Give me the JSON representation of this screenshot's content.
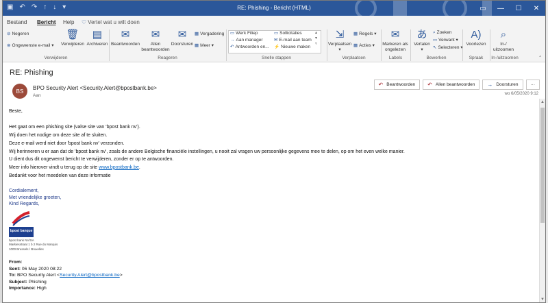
{
  "window": {
    "title": "RE: Phishing  -  Bericht (HTML)"
  },
  "tabs": [
    {
      "label": "Bestand"
    },
    {
      "label": "Bericht"
    },
    {
      "label": "Help"
    }
  ],
  "tell_me": "Vertel wat u wilt doen",
  "ribbon": {
    "delete": {
      "negeren": "Negeren",
      "junk": "Ongewenste e-mail",
      "verwijderen": "Verwijderen",
      "archiveren": "Archiveren",
      "group": "Verwijderen"
    },
    "respond": {
      "beantwoorden": "Beantwoorden",
      "allen": "Allen beantwoorden",
      "doorsturen": "Doorsturen",
      "vergadering": "Vergadering",
      "meer": "Meer",
      "group": "Reageren"
    },
    "quick": {
      "items": [
        "Werk Filiep",
        "Aan manager",
        "Antwoorden en...",
        "Sollicitaties",
        "E-mail aan team",
        "Nieuwe maken"
      ],
      "group": "Snelle stappen"
    },
    "move": {
      "verplaatsen": "Verplaatsen",
      "regels": "Regels",
      "acties": "Acties",
      "group": "Verplaatsen"
    },
    "tags": {
      "markeren": "Markeren als ongelezen",
      "group": "Labels"
    },
    "edit": {
      "vertalen": "Vertalen",
      "zoeken": "Zoeken",
      "verwant": "Verwant",
      "selecteren": "Selecteren",
      "group": "Bewerken"
    },
    "speech": {
      "voorlezen": "Voorlezen",
      "group": "Spraak"
    },
    "zoom": {
      "inuit": "In-/ uitzoomen",
      "group": "In-/uitzoomen"
    }
  },
  "message": {
    "subject": "RE: Phishing",
    "avatar_initials": "BS",
    "sender": "BPO Security Alert <Security.Alert@bpostbank.be>",
    "to_label": "Aan",
    "date": "wo 6/05/2020 9:12",
    "actions": {
      "reply": "Beantwoorden",
      "reply_all": "Allen beantwoorden",
      "forward": "Doorsturen",
      "more": "···"
    },
    "greeting": "Beste,",
    "lines": [
      "Het gaat om een phishing site (valse site van 'bpost bank nv').",
      "Wij doen het nodige om deze site af te sluiten.",
      "Deze e-mail werd niet door 'bpost bank nv' verzonden.",
      "Wij herinneren u er aan dat de 'bpost bank nv', zoals de andere Belgische financiële instellingen, u nooit zal vragen uw persoonlijke gegevens mee te delen, op om het even welke manier.",
      "U dient dus dit ongewenst bericht te verwijderen, zonder er op te antwoorden."
    ],
    "info_prefix": "Meer info hierover vindt u terug op de site ",
    "info_link": "www.bpostbank.be",
    "info_suffix": ".",
    "thanks": "Bedankt voor het meedelen van deze informatie",
    "signature": [
      "Cordialement,",
      "Met vriendelijke groeten,",
      "Kind Regards,"
    ],
    "logo_text": "bpost banque",
    "address": [
      "bpost bank NV/SA",
      "Markiesstraat 1 b 2 Rue du Marquis",
      "1000 Brussels / Bruxelles"
    ],
    "header": {
      "from_label": "From:",
      "sent_label": "Sent:",
      "sent_value": " 06 May 2020 08:22",
      "to_label": "To:",
      "to_value": " BPO Security Alert <",
      "to_link": "Security.Alert@bpostbank.be",
      "to_end": ">",
      "subject_label": "Subject:",
      "subject_value": " Phishing",
      "importance_label": "Importance:",
      "importance_value": " High"
    }
  }
}
